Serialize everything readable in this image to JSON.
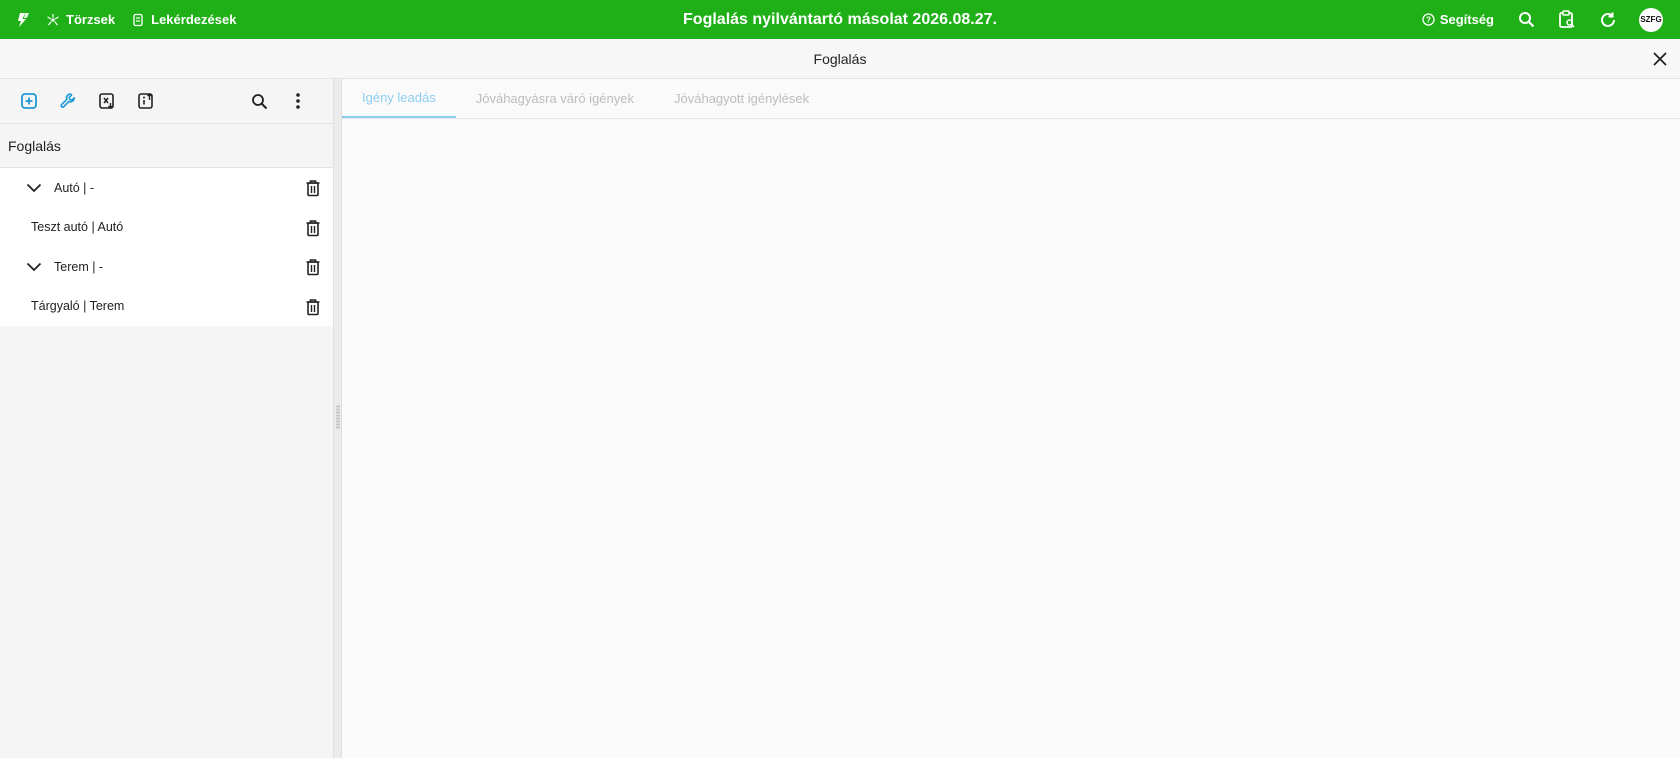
{
  "topbar": {
    "logo_icon": "lightning-logo-icon",
    "nav": [
      {
        "icon": "hub-icon",
        "label": "Törzsek"
      },
      {
        "icon": "document-list-icon",
        "label": "Lekérdezések"
      }
    ],
    "title": "Foglalás nyilvántartó másolat 2026.08.27.",
    "help_label": "Segítség",
    "icons": [
      "search-icon",
      "clipboard-search-icon",
      "refresh-icon"
    ],
    "avatar": "SZFG",
    "color": "#1faf17"
  },
  "subheader": {
    "title": "Foglalás",
    "close_icon": "close-icon"
  },
  "sidebar": {
    "toolbar_icons": [
      "add-box-icon",
      "wrench-icon",
      "excel-export-icon",
      "info-export-icon",
      "search-icon",
      "more-vertical-icon"
    ],
    "title": "Foglalás",
    "tree": [
      {
        "type": "group",
        "label": "Autó | -"
      },
      {
        "type": "leaf",
        "label": "Teszt autó | Autó"
      },
      {
        "type": "group",
        "label": "Terem | -"
      },
      {
        "type": "leaf",
        "label": "Tárgyaló | Terem"
      }
    ]
  },
  "main": {
    "tabs": [
      {
        "label": "Igény leadás",
        "active": true
      },
      {
        "label": "Jóváhagyásra váró igények",
        "active": false
      },
      {
        "label": "Jóváhagyott igénylések",
        "active": false
      }
    ],
    "accent": "#8ecdf0"
  }
}
